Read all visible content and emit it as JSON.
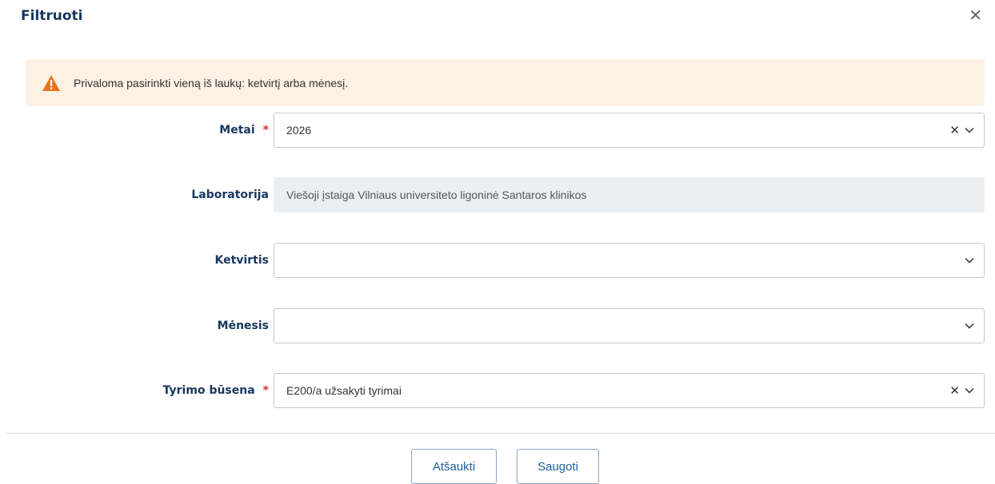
{
  "modal": {
    "title": "Filtruoti",
    "close_icon": "close-icon"
  },
  "alert": {
    "icon": "warning-icon",
    "text": "Privaloma pasirinkti vieną iš laukų: ketvirtį arba mėnesį.",
    "background": "#fdf1e3",
    "icon_color": "#e8731c"
  },
  "form": {
    "metai": {
      "label": "Metai",
      "required_mark": "*",
      "value": "2026"
    },
    "laboratorija": {
      "label": "Laboratorija",
      "value": "Viešoji įstaiga Vilniaus universiteto ligoninė Santaros klinikos"
    },
    "ketvirtis": {
      "label": "Ketvirtis",
      "value": ""
    },
    "menesis": {
      "label": "Mėnesis",
      "value": ""
    },
    "tyrimo_busena": {
      "label": "Tyrimo būsena",
      "required_mark": "*",
      "value": "E200/a užsakyti tyrimai"
    }
  },
  "footer": {
    "cancel_label": "Atšaukti",
    "save_label": "Saugoti"
  }
}
